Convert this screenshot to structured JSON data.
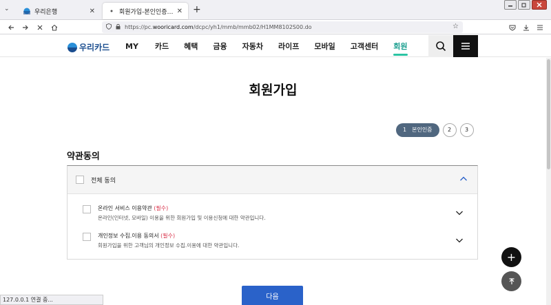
{
  "browser": {
    "tabs": [
      {
        "title": "우리은행",
        "active": false
      },
      {
        "title": "회원가입-본인인증 | 우리카드",
        "active": true
      }
    ],
    "new_tab_glyph": "+",
    "url_prefix": "https://pc.",
    "url_host": "wooricard.com",
    "url_path": "/dcpc/yh1/mmb/mmb02/H1MM8102S00.do",
    "status_text": "127.0.0.1 연결 중..."
  },
  "site": {
    "logo_text": "우리카드",
    "brand_color": "#1a4d8f",
    "accent_color": "#2bc4a3",
    "nav": [
      "MY",
      "카드",
      "혜택",
      "금융",
      "자동차",
      "라이프",
      "모바일",
      "고객센터",
      "회원"
    ],
    "active_nav": "회원"
  },
  "page": {
    "title": "회원가입",
    "steps": {
      "active_num": "1",
      "active_label": "본인인증",
      "others": [
        "2",
        "3"
      ]
    },
    "section_title": "약관동의",
    "agree_all_label": "전체 동의",
    "terms": [
      {
        "title": "온라인 서비스 이용약관 ",
        "required": "(필수)",
        "desc": "온라인(인터넷, 모바일) 이용을 위한 회원가입 및 이용신청에 대한 약관입니다."
      },
      {
        "title": "개인정보 수집.이용 동의서 ",
        "required": "(필수)",
        "desc": "회원가입을 위한 고객님의 개인정보 수집.이용에 대한 약관입니다."
      }
    ],
    "next_button": "다음",
    "fab_plus": "+"
  }
}
